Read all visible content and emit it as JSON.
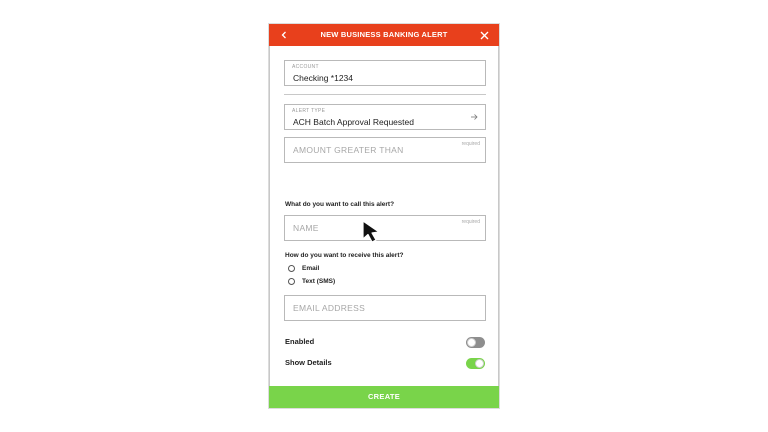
{
  "colors": {
    "accent": "#e8401c",
    "green": "#79d44a"
  },
  "header": {
    "title": "NEW BUSINESS BANKING ALERT",
    "back_icon": "chevron-left-icon",
    "close_icon": "close-icon"
  },
  "account": {
    "label": "ACCOUNT",
    "value": "Checking *1234"
  },
  "alert_type": {
    "label": "ALERT TYPE",
    "value": "ACH Batch Approval Requested",
    "icon": "arrow-right-icon"
  },
  "amount": {
    "placeholder": "AMOUNT GREATER THAN",
    "required": "required"
  },
  "name_section": {
    "question": "What do you want to call this alert?",
    "placeholder": "NAME",
    "required": "required"
  },
  "delivery": {
    "question": "How do you want to receive this alert?",
    "options": [
      {
        "label": "Email"
      },
      {
        "label": "Text (SMS)"
      }
    ]
  },
  "email": {
    "placeholder": "EMAIL ADDRESS"
  },
  "toggles": {
    "enabled": {
      "label": "Enabled",
      "on": false
    },
    "show_details": {
      "label": "Show Details",
      "on": true
    }
  },
  "create_button": {
    "label": "CREATE"
  }
}
